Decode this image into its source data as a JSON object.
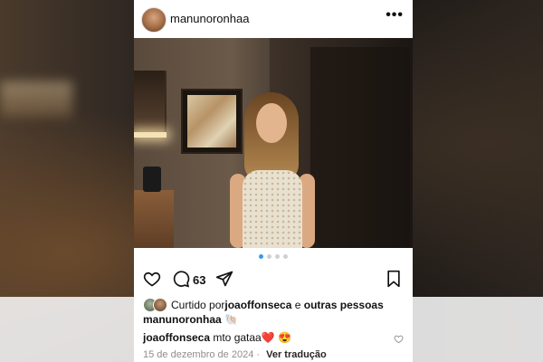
{
  "post": {
    "username": "manunoronhaa",
    "menu_icon": "more-horizontal-icon"
  },
  "carousel": {
    "slides": 4,
    "active_index": 0
  },
  "actions": {
    "comment_count": "63",
    "icons": [
      "heart-icon",
      "comment-icon",
      "share-icon",
      "bookmark-icon"
    ]
  },
  "likes": {
    "prefix": "Curtido por ",
    "user": "joaoffonseca",
    "middle": " e ",
    "suffix": "outras pessoas"
  },
  "caption": {
    "username": "manunoronhaa",
    "text": "🐚"
  },
  "comment": {
    "username": "joaoffonseca",
    "text": " mto gataa",
    "emoji1": "❤️",
    "emoji2": "😍"
  },
  "footer": {
    "date": "15 de dezembro de 2024",
    "separator": " · ",
    "translate": "Ver tradução"
  },
  "colors": {
    "accent": "#3897f0",
    "text": "#111111",
    "muted": "#8e8e8e"
  }
}
